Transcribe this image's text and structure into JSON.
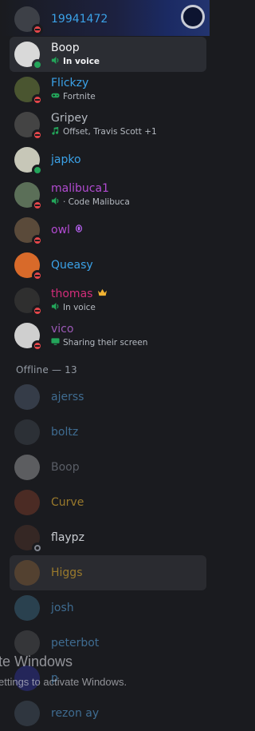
{
  "online_members": [
    {
      "name": "19941472",
      "name_color": "#3ba2e8",
      "status": "dnd",
      "activity": "",
      "activity_icon": "",
      "avatar_color": "#3d4047"
    },
    {
      "name": "Boop",
      "name_color": "#f2f3f5",
      "status": "online",
      "activity": "In voice",
      "activity_icon": "voice-icon",
      "avatar_color": "#d9d9d9",
      "selected": true
    },
    {
      "name": "Flickzy",
      "name_color": "#3ba2e8",
      "status": "dnd",
      "activity": "Fortnite",
      "activity_icon": "gamepad-icon",
      "avatar_color": "#4a5530"
    },
    {
      "name": "Gripey",
      "name_color": "#b5bac1",
      "status": "dnd",
      "activity": "Offset, Travis Scott +1",
      "activity_icon": "music-note-icon",
      "avatar_color": "#444444"
    },
    {
      "name": "japko",
      "name_color": "#3ba2e8",
      "status": "online",
      "activity": "",
      "activity_icon": "",
      "avatar_color": "#c7c7b8"
    },
    {
      "name": "malibuca1",
      "name_color": "#b24bd1",
      "status": "dnd",
      "activity": "· Code Malibuca",
      "activity_icon": "voice-icon",
      "avatar_color": "#5b6f58"
    },
    {
      "name": "owl",
      "name_color": "#b24bd1",
      "status": "dnd",
      "activity": "",
      "activity_icon": "",
      "avatar_color": "#5a4a3a",
      "badge": "gem-icon"
    },
    {
      "name": "Queasy",
      "name_color": "#3ba2e8",
      "status": "dnd",
      "activity": "",
      "activity_icon": "",
      "avatar_color": "#d86a2a"
    },
    {
      "name": "thomas",
      "name_color": "#d22d7a",
      "status": "dnd",
      "activity": "In voice",
      "activity_icon": "voice-icon",
      "avatar_color": "#2f2f2f",
      "badge": "crown-icon"
    },
    {
      "name": "vico",
      "name_color": "#9b59b6",
      "status": "dnd",
      "activity": "Sharing their screen",
      "activity_icon": "screen-share-icon",
      "avatar_color": "#cfcfcf"
    }
  ],
  "offline_header": "Offline — 13",
  "offline_members": [
    {
      "name": "ajerss",
      "name_color": "#3f6c91",
      "avatar_color": "#6a7b95"
    },
    {
      "name": "boltz",
      "name_color": "#3f6c91",
      "avatar_color": "#505a60"
    },
    {
      "name": "Boop",
      "name_color": "#5a5e66",
      "avatar_color": "#d9d9d9"
    },
    {
      "name": "Curve",
      "name_color": "#9a7a2c",
      "avatar_color": "#a84a2f"
    },
    {
      "name": "flaypz",
      "name_color": "#c9ccd1",
      "avatar_color": "#6a3f2f",
      "status": "offline"
    },
    {
      "name": "Higgs",
      "name_color": "#9a7a2c",
      "avatar_color": "#a06a30"
    },
    {
      "name": "josh",
      "name_color": "#3f6c91",
      "avatar_color": "#4a8aa8"
    },
    {
      "name": "peterbot",
      "name_color": "#3f6c91",
      "avatar_color": "#6a6a6a"
    },
    {
      "name": "p",
      "name_color": "#3f6c91",
      "avatar_color": "#3a3cc8"
    },
    {
      "name": "rezon ay",
      "name_color": "#3f6c91",
      "avatar_color": "#5a6a7a"
    }
  ],
  "watermark": {
    "line1": "te Windows",
    "line2": "ettings to activate Windows."
  },
  "colors": {
    "background": "#1a1b1f",
    "selected_row": "#2b2d33",
    "online": "#23a55a",
    "dnd": "#e5464a"
  }
}
